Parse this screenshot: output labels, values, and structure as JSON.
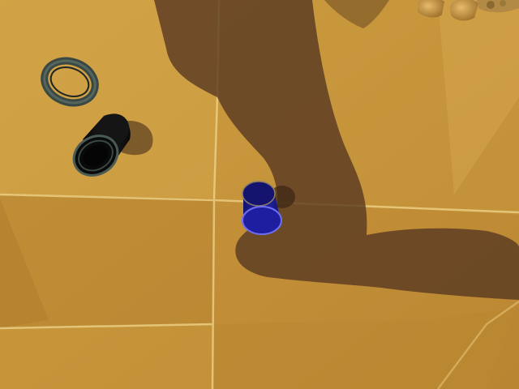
{
  "scene": {
    "kind": "rendered-3d-workspace",
    "floor_colors": {
      "tile_light": "#d2a445",
      "tile_mid": "#c4913a",
      "tile_dark": "#a97a29",
      "grid_line": "#f2d58a",
      "shadow": "#5a3a22"
    },
    "objects": [
      {
        "name": "black-ring",
        "color": "#4a5a55"
      },
      {
        "name": "black-cylinder",
        "color": "#0d0d0d"
      },
      {
        "name": "blue-cylinder",
        "color": "#1a1a8c"
      },
      {
        "name": "robot-gripper-fingers",
        "color": "#c89a4a"
      }
    ]
  }
}
